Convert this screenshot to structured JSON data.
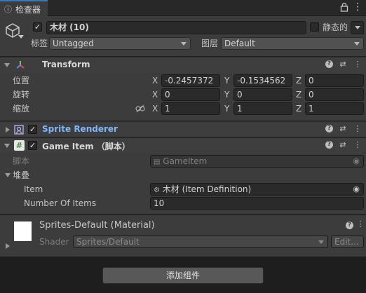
{
  "window": {
    "tab_title": "检查器"
  },
  "object": {
    "name": "木材 (10)",
    "active": true,
    "static_label": "静态的",
    "static_checked": false,
    "tag_label": "标签",
    "tag_value": "Untagged",
    "layer_label": "图层",
    "layer_value": "Default"
  },
  "transform": {
    "title": "Transform",
    "position_label": "位置",
    "rotation_label": "旋转",
    "scale_label": "缩放",
    "axis_x": "X",
    "axis_y": "Y",
    "axis_z": "Z",
    "position": {
      "x": "-0.2457372",
      "y": "-0.1534562",
      "z": "0"
    },
    "rotation": {
      "x": "0",
      "y": "0",
      "z": "0"
    },
    "scale": {
      "x": "1",
      "y": "1",
      "z": "1"
    }
  },
  "sprite_renderer": {
    "title": "Sprite Renderer",
    "enabled": true
  },
  "game_item": {
    "title": "Game Item  （脚本）",
    "script_label": "脚本",
    "script_value": "GameItem",
    "stack_label": "堆叠",
    "item_label": "Item",
    "item_value": "木材 (Item Definition)",
    "count_label": "Number Of Items",
    "count_value": "10"
  },
  "material": {
    "title": "Sprites-Default (Material)",
    "shader_label": "Shader",
    "shader_value": "Sprites/Default",
    "edit_label": "Edit..."
  },
  "add_component_label": "添加组件",
  "colors": {
    "accent_blue": "#7bb6ff",
    "panel": "#3c3c3c",
    "header": "#3e3e3e"
  }
}
